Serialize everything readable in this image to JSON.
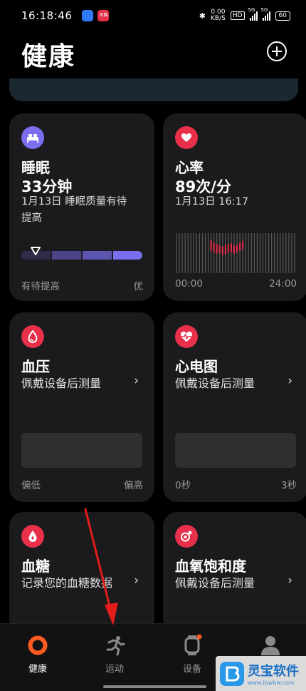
{
  "status_bar": {
    "time": "16:18:46",
    "app_badge_text": "天猫",
    "speed": "0.00",
    "speed_unit": "KB/S",
    "hd": "HD",
    "sig1": "5G",
    "sig2": "5G",
    "battery": "60"
  },
  "header": {
    "title": "健康"
  },
  "cards": {
    "sleep": {
      "title": "睡眠",
      "value": "33分钟",
      "sub_line1": "1月13日 睡眠质量有待",
      "sub_line2": "提高",
      "axis_left": "有待提高",
      "axis_right": "优",
      "quality_fraction": 0.12,
      "icon_color": "#7b6ff0"
    },
    "heart_rate": {
      "title": "心率",
      "value": "89次/分",
      "sub": "1月13日 16:17",
      "axis_left": "00:00",
      "axis_right": "24:00",
      "icon_color": "#e8304a"
    },
    "blood_pressure": {
      "title": "血压",
      "desc": "佩戴设备后测量",
      "axis_left": "偏低",
      "axis_right": "偏高",
      "icon_color": "#e8304a"
    },
    "ecg": {
      "title": "心电图",
      "desc": "佩戴设备后测量",
      "axis_left": "0秒",
      "axis_right": "3秒",
      "icon_color": "#e8304a"
    },
    "blood_sugar": {
      "title": "血糖",
      "desc": "记录您的血糖数据",
      "icon_color": "#e8304a"
    },
    "spo2": {
      "title": "血氧饱和度",
      "desc": "佩戴设备后测量",
      "icon_color": "#e8304a"
    }
  },
  "nav": {
    "items": [
      {
        "label": "健康",
        "icon": "health-ring-icon",
        "active": true
      },
      {
        "label": "运动",
        "icon": "running-icon",
        "active": false
      },
      {
        "label": "设备",
        "icon": "watch-icon",
        "active": false
      },
      {
        "label": "我的",
        "icon": "person-icon",
        "active": false
      }
    ],
    "active_color": "#ff5a1f"
  },
  "watermark": {
    "title": "灵宝软件",
    "url": "www.lbwbw.com"
  }
}
